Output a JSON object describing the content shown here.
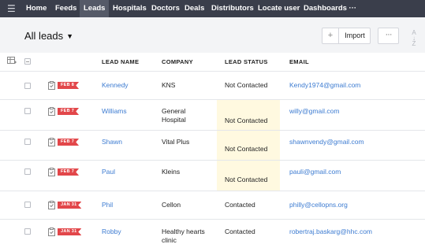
{
  "nav": {
    "menu_icon": "hamburger-icon",
    "items": [
      {
        "label": "Home"
      },
      {
        "label": "Feeds"
      },
      {
        "label": "Leads",
        "active": true
      },
      {
        "label": "Hospitals"
      },
      {
        "label": "Doctors"
      },
      {
        "label": "Deals"
      },
      {
        "label": "Distributors"
      },
      {
        "label": "Locate user"
      },
      {
        "label": "Dashboards ···"
      }
    ]
  },
  "header": {
    "title": "All leads",
    "add_icon": "+",
    "import_label": "Import",
    "more_label": "···",
    "sort_icon": "sort-az-icon"
  },
  "table": {
    "columns": [
      "LEAD NAME",
      "COMPANY",
      "LEAD STATUS",
      "EMAIL"
    ],
    "rows": [
      {
        "date": "FEB 8",
        "lead": "Kennedy",
        "company": "KNS",
        "status": "Not Contacted",
        "email": "Kendy1974@gmail.com"
      },
      {
        "date": "FEB 7",
        "lead": "Williams",
        "company": "General Hospital",
        "status": "Not Contacted",
        "email": "willy@gmail.com"
      },
      {
        "date": "FEB 7",
        "lead": "Shawn",
        "company": "Vital Plus",
        "status": "Not Contacted",
        "email": "shawnvendy@gmail.com"
      },
      {
        "date": "FEB 7",
        "lead": "Paul",
        "company": "Kleins",
        "status": "Not Contacted",
        "email": "pauli@gmail.com"
      },
      {
        "date": "JAN 31",
        "lead": "Phil",
        "company": "Cellon",
        "status": "Contacted",
        "email": "philly@cellopns.org"
      },
      {
        "date": "JAN 31",
        "lead": "Robby",
        "company": "Healthy hearts clinic",
        "status": "Contacted",
        "email": "robertraj.baskarg@hhc.com"
      }
    ]
  },
  "colors": {
    "nav_bg": "#3a3e4b",
    "link": "#3c7bd1",
    "date_tag": "#e2474a",
    "highlight": "#fff9e0"
  }
}
